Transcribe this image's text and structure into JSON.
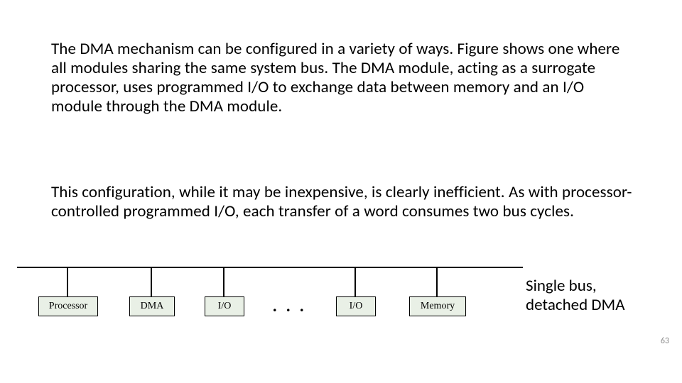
{
  "paragraph1": "The DMA mechanism can be configured in a variety of ways. Figure shows one where all modules sharing the same system bus. The DMA module, acting as a surrogate processor, uses programmed I/O to exchange data between memory and an I/O module through the DMA module.",
  "paragraph2": "This configuration, while it may be inexpensive, is clearly inefficient. As with processor-controlled programmed I/O, each transfer of a word consumes two bus cycles.",
  "caption": "Single bus, detached DMA",
  "page_number": "63",
  "diagram": {
    "blocks": [
      "Processor",
      "DMA",
      "I/O",
      "I/O",
      "Memory"
    ],
    "ellipsis": ". . ."
  }
}
